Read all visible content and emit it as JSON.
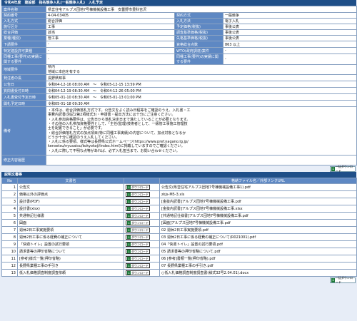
{
  "header": {
    "title": "令和4年度　建設部　指名競争入札(一般競争入札)　入札予定"
  },
  "info": {
    "rows": [
      [
        {
          "l": "案件名称",
          "v": "県営住宅アルプス団地7号棟機械設備工事　安曇野市豊科吉沢"
        }
      ],
      [
        {
          "l": "契約番号",
          "v": "4-04-03405"
        },
        {
          "l": "契約方式",
          "v": "一般競争"
        }
      ],
      [
        {
          "l": "入札方式",
          "v": "総合評価"
        },
        {
          "l": "入札方法",
          "v": "電子入札"
        }
      ],
      [
        {
          "l": "施行区分",
          "v": "工事"
        },
        {
          "l": "予定価格(税抜)",
          "v": "事後公表"
        }
      ],
      [
        {
          "l": "総合評価",
          "v": "該当"
        },
        {
          "l": "調査基準価格(税抜)",
          "v": "事後公表"
        }
      ],
      [
        {
          "l": "業種(種別)",
          "v": "管工事"
        },
        {
          "l": "失格基準価格(税抜)",
          "v": "事後公表"
        }
      ],
      [
        {
          "l": "下請要件",
          "v": "-"
        },
        {
          "l": "資格総合点数",
          "v": "863 以上"
        }
      ],
      [
        {
          "l": "特定建設許可業種",
          "v": "-"
        },
        {
          "l": "WTO(政府調達)案件",
          "v": "-"
        }
      ],
      [
        {
          "l": "同種工事(要件)の実績に関する要件",
          "v": "-"
        },
        {
          "l": "同種工事(要件)の実績に関する要件",
          "v": "-"
        }
      ],
      [
        {
          "l": "地域要件",
          "v": [
            "県内",
            "地域に本店を有する"
          ]
        }
      ],
      [
        {
          "l": "発注者の長",
          "v": "長野県知事"
        }
      ],
      [
        {
          "l": "公告日",
          "v": "令和04-12-16 08:00 AM　〜　令和05-12-15 13:59 PM"
        }
      ],
      [
        {
          "l": "質問書受付日時",
          "v": "令和04-12-19 08:30 AM　〜　令和04-12-26 05:00 PM"
        }
      ],
      [
        {
          "l": "入札書受付予定日時",
          "v": "令和05-01-10 08:30 AM　〜　令和05-01-13 01:00 PM"
        }
      ],
      [
        {
          "l": "開札予定日時",
          "v": "令和05-01-18 09:30 AM"
        }
      ],
      [
        {
          "l": "備考",
          "v": [
            "・本件は、総合評価落札方式です。公告文をよく読み日程等をご確認のうえ、入札書・工",
            "事費内訳書(別記2第2項様式3)・申請書・提出方法には十分にご注意ください。",
            "・入札参加資格要件は、公告日から落札決定日まで満たしていることが必要となります。",
            "・その他の入札参加資格要件として、「主任(監理)技術者として、一級管工事施工管理技",
            "士を配置できること」が必要です。",
            "・総合評価落札方式の加点項目(特に同種工事実績)の内容について、加点対象となるか",
            "どうか十分に確認のうえ入札してください。",
            "・入札に係る要領、様式等は長野県公式ホームページ(https://www.pref.nagano.lg.jp/",
            "kensetsu/nyusatsu/kokyokoji/index.html)に掲載していますのでご確認ください。",
            "・入札に際して不明な点等があれば、必ず入札担当まで、お問い合わせください。"
          ]
        }
      ],
      [
        {
          "l": "修正内容履歴",
          "v": ""
        }
      ]
    ]
  },
  "download_all_label": "一括ダウンロード",
  "docs": {
    "section_title": "説明文書等",
    "headers": [
      "No",
      "文書名",
      "",
      "格納ファイル名／外部リンクURL"
    ],
    "dl_label": "ダウンロード",
    "rows": [
      {
        "no": "1",
        "name": "公告文",
        "file": "公告文(県営住宅アルプス団地7号棟機械設備工事1).pdf"
      },
      {
        "no": "2",
        "name": "価格以外の評価点",
        "file": "zkjs-M5-3.xls"
      },
      {
        "no": "3",
        "name": "設計書(PDF)",
        "file": "[金抜内訳書]アルプス団地7号棟機械設備工事.pdf"
      },
      {
        "no": "4",
        "name": "設計書(xlsx)",
        "file": "[金抜内訳書]アルプス団地7号棟機械設備工事.xlsx"
      },
      {
        "no": "5",
        "name": "共通特記仕様書",
        "file": "[共通特記仕様書]アルプス団地7号棟機械設備工事.pdf"
      },
      {
        "no": "6",
        "name": "図面",
        "file": "[図面]アルプス団地7号棟機械設備工事.pdf"
      },
      {
        "no": "7",
        "name": "週休2日工事実施要領",
        "file": "02 週休2日工事実施要領.pdf"
      },
      {
        "no": "8",
        "name": "週休2日工事に係る経費の補正について",
        "file": "03 週休2日工事に係る経費の補正について(R021001).pdf"
      },
      {
        "no": "9",
        "name": "「快適トイレ」設置の試行要領",
        "file": "04「快適トイレ」設置の試行要領.pdf"
      },
      {
        "no": "10",
        "name": "請求書等の押印省略について",
        "file": "05 請求書等の押印省略について.pdf"
      },
      {
        "no": "11",
        "name": "[参考]様式一覧(押印省略)",
        "file": "06 [参考]書類一覧(押印省略).pdf"
      },
      {
        "no": "12",
        "name": "長野県業種工事の手引き",
        "file": "07 長野県業種工事の手引き.pdf"
      },
      {
        "no": "13",
        "name": "低入札価格調査制度調査依頼",
        "file": "○低入札価格調査制度調査書(様式32号2.04.01).docx"
      }
    ]
  }
}
